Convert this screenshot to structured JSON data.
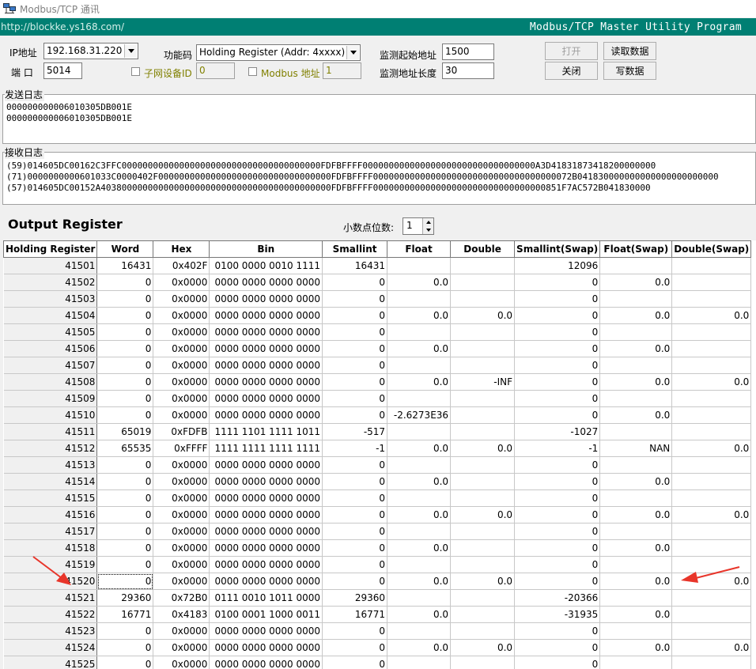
{
  "window": {
    "title": "Modbus/TCP 通讯",
    "app_icon": "network-computers-icon"
  },
  "banner": {
    "url": "http://blockke.ys168.com/",
    "utility": "Modbus/TCP  Master Utility Program",
    "color": "#007f73"
  },
  "connection": {
    "ip_label": "IP地址",
    "ip_value": "192.168.31.220",
    "port_label": "端  口",
    "port_value": "5014",
    "function_label": "功能码",
    "function_value": "Holding Register (Addr: 4xxxx)",
    "subnet_label": "子网设备ID",
    "subnet_value": "0",
    "modbus_addr_label": "Modbus 地址",
    "modbus_addr_value": "1",
    "start_label": "监测起始地址",
    "start_value": "1500",
    "length_label": "监测地址长度",
    "length_value": "30"
  },
  "buttons": {
    "open": "打开",
    "close": "关闭",
    "read": "读取数据",
    "write": "写数据"
  },
  "send_log": {
    "title": "发送日志",
    "lines": [
      "000000000006010305DB001E",
      "000000000006010305DB001E"
    ]
  },
  "recv_log": {
    "title": "接收日志",
    "lines": [
      "(59)014605DC00162C3FFC00000000000000000000000000000000000000FDFBFFFF000000000000000000000000000000000A3D41831873418200000000",
      "(71)0000000000601033C0000402F000000000000000000000000000000000FDFBFFFF00000000000000000000000000000000000072B041830000000000000000000000",
      "(57)014605DC00152A40380000000000000000000000000000000000000000FDFBFFFF000000000000000000000000000000000851F7AC572B041830000"
    ]
  },
  "output": {
    "title": "Output Register",
    "decimals_label": "小数点位数:",
    "decimals_value": "1"
  },
  "table": {
    "headers": [
      "Holding Register",
      "Word",
      "Hex",
      "Bin",
      "Smallint",
      "Float",
      "Double",
      "Smallint(Swap)",
      "Float(Swap)",
      "Double(Swap)"
    ],
    "rows": [
      [
        "41501",
        "16431",
        "0x402F",
        "0100 0000 0010 1111",
        "16431",
        "",
        "",
        "12096",
        "",
        ""
      ],
      [
        "41502",
        "0",
        "0x0000",
        "0000 0000 0000 0000",
        "0",
        "0.0",
        "",
        "0",
        "0.0",
        ""
      ],
      [
        "41503",
        "0",
        "0x0000",
        "0000 0000 0000 0000",
        "0",
        "",
        "",
        "0",
        "",
        ""
      ],
      [
        "41504",
        "0",
        "0x0000",
        "0000 0000 0000 0000",
        "0",
        "0.0",
        "0.0",
        "0",
        "0.0",
        "0.0"
      ],
      [
        "41505",
        "0",
        "0x0000",
        "0000 0000 0000 0000",
        "0",
        "",
        "",
        "0",
        "",
        ""
      ],
      [
        "41506",
        "0",
        "0x0000",
        "0000 0000 0000 0000",
        "0",
        "0.0",
        "",
        "0",
        "0.0",
        ""
      ],
      [
        "41507",
        "0",
        "0x0000",
        "0000 0000 0000 0000",
        "0",
        "",
        "",
        "0",
        "",
        ""
      ],
      [
        "41508",
        "0",
        "0x0000",
        "0000 0000 0000 0000",
        "0",
        "0.0",
        "-INF",
        "0",
        "0.0",
        "0.0"
      ],
      [
        "41509",
        "0",
        "0x0000",
        "0000 0000 0000 0000",
        "0",
        "",
        "",
        "0",
        "",
        ""
      ],
      [
        "41510",
        "0",
        "0x0000",
        "0000 0000 0000 0000",
        "0",
        "-2.6273E36",
        "",
        "0",
        "0.0",
        ""
      ],
      [
        "41511",
        "65019",
        "0xFDFB",
        "1111 1101 1111 1011",
        "-517",
        "",
        "",
        "-1027",
        "",
        ""
      ],
      [
        "41512",
        "65535",
        "0xFFFF",
        "1111 1111 1111 1111",
        "-1",
        "0.0",
        "0.0",
        "-1",
        "NAN",
        "0.0"
      ],
      [
        "41513",
        "0",
        "0x0000",
        "0000 0000 0000 0000",
        "0",
        "",
        "",
        "0",
        "",
        ""
      ],
      [
        "41514",
        "0",
        "0x0000",
        "0000 0000 0000 0000",
        "0",
        "0.0",
        "",
        "0",
        "0.0",
        ""
      ],
      [
        "41515",
        "0",
        "0x0000",
        "0000 0000 0000 0000",
        "0",
        "",
        "",
        "0",
        "",
        ""
      ],
      [
        "41516",
        "0",
        "0x0000",
        "0000 0000 0000 0000",
        "0",
        "0.0",
        "0.0",
        "0",
        "0.0",
        "0.0"
      ],
      [
        "41517",
        "0",
        "0x0000",
        "0000 0000 0000 0000",
        "0",
        "",
        "",
        "0",
        "",
        ""
      ],
      [
        "41518",
        "0",
        "0x0000",
        "0000 0000 0000 0000",
        "0",
        "0.0",
        "",
        "0",
        "0.0",
        ""
      ],
      [
        "41519",
        "0",
        "0x0000",
        "0000 0000 0000 0000",
        "0",
        "",
        "",
        "0",
        "",
        ""
      ],
      [
        "41520",
        "0",
        "0x0000",
        "0000 0000 0000 0000",
        "0",
        "0.0",
        "0.0",
        "0",
        "0.0",
        "0.0"
      ],
      [
        "41521",
        "29360",
        "0x72B0",
        "0111 0010 1011 0000",
        "29360",
        "",
        "",
        "-20366",
        "",
        ""
      ],
      [
        "41522",
        "16771",
        "0x4183",
        "0100 0001 1000 0011",
        "16771",
        "0.0",
        "",
        "-31935",
        "0.0",
        ""
      ],
      [
        "41523",
        "0",
        "0x0000",
        "0000 0000 0000 0000",
        "0",
        "",
        "",
        "0",
        "",
        ""
      ],
      [
        "41524",
        "0",
        "0x0000",
        "0000 0000 0000 0000",
        "0",
        "0.0",
        "0.0",
        "0",
        "0.0",
        "0.0"
      ],
      [
        "41525",
        "0",
        "0x0000",
        "0000 0000 0000 0000",
        "0",
        "",
        "",
        "0",
        "",
        ""
      ]
    ]
  },
  "colors": {
    "annotation_arrow": "#e8352a"
  }
}
